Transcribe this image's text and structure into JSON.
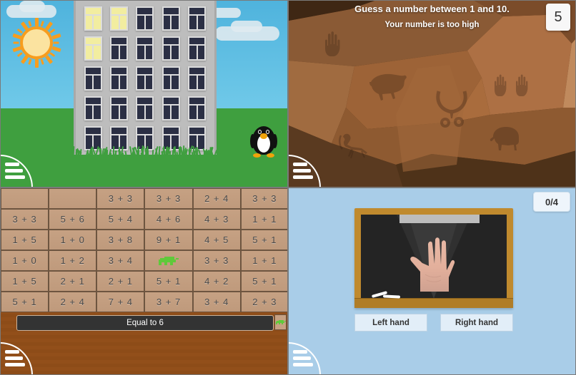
{
  "panels": {
    "penguin_building": {
      "name": "penguin-building-scene",
      "menu_icon": "hamburger-menu-icon",
      "sun_icon": "sun-icon",
      "penguin_icon": "penguin-icon",
      "building_icon": "apartment-building-icon",
      "building": {
        "rows": 5,
        "cols": 5,
        "lit_windows": [
          [
            0,
            0
          ],
          [
            0,
            1
          ],
          [
            1,
            0
          ]
        ]
      },
      "colors": {
        "sky": "#5cbede",
        "ground": "#3f9f3f",
        "building": "#bdbdbd",
        "window_dark": "#2b2f44",
        "window_lit": "#f2eda0",
        "sun": "#f79d1e"
      }
    },
    "guess_number": {
      "name": "guess-the-number-game",
      "title": "Guess a number between 1 and 10.",
      "feedback": "Your number is too high",
      "current_guess": "5",
      "menu_icon": "hamburger-menu-icon",
      "helicopter_icon": "helicopter-icon",
      "cave_paintings": [
        "hand-print",
        "bison",
        "ibex",
        "hunter",
        "two-hand-prints",
        "elephant"
      ],
      "colors": {
        "cave_dark": "#4e3219",
        "cave_mid": "#8a5a35",
        "cave_light": "#b0leaf",
        "badge_bg": "#f7f7f7"
      }
    },
    "math_grid": {
      "name": "math-sums-grid-game",
      "goal_label": "Equal to 6",
      "menu_icon": "hamburger-menu-icon",
      "player_icon": "crocodile-sprite",
      "goal_player_icon": "crocodile-sprite",
      "player_position": {
        "row": 3,
        "col": 3
      },
      "colors": {
        "tile": "#c6a183",
        "tile_border": "#6d5540",
        "wood": "#8d4c18",
        "goalbar": "#333333",
        "sprite": "#5fc93a"
      },
      "grid": [
        [
          "",
          "",
          "3 + 3",
          "3 + 3",
          "2 + 4",
          "3 + 3"
        ],
        [
          "3 + 3",
          "5 + 6",
          "5 + 4",
          "4 + 6",
          "4 + 3",
          "1 + 1"
        ],
        [
          "1 + 5",
          "1 + 0",
          "3 + 8",
          "9 + 1",
          "4 + 5",
          "5 + 1"
        ],
        [
          "1 + 0",
          "1 + 2",
          "3 + 4",
          "",
          "3 + 3",
          "1 + 1"
        ],
        [
          "1 + 5",
          "2 + 1",
          "2 + 1",
          "5 + 1",
          "4 + 2",
          "5 + 1"
        ],
        [
          "5 + 1",
          "2 + 4",
          "7 + 4",
          "3 + 7",
          "3 + 4",
          "2 + 3"
        ]
      ]
    },
    "hand_quiz": {
      "name": "left-or-right-hand-quiz",
      "score": "0/4",
      "menu_icon": "hamburger-menu-icon",
      "blackboard_icon": "blackboard-icon",
      "hand_icon": "open-palm-hand-photo",
      "chalk_icon": "chalk-icon",
      "buttons": [
        {
          "label": "Left hand",
          "name": "left-hand-button"
        },
        {
          "label": "Right hand",
          "name": "right-hand-button"
        }
      ],
      "colors": {
        "background": "#a9cde8",
        "board_frame": "#c08a2e",
        "board_surface": "#242424",
        "button_bg": "#e2eef8"
      }
    }
  }
}
